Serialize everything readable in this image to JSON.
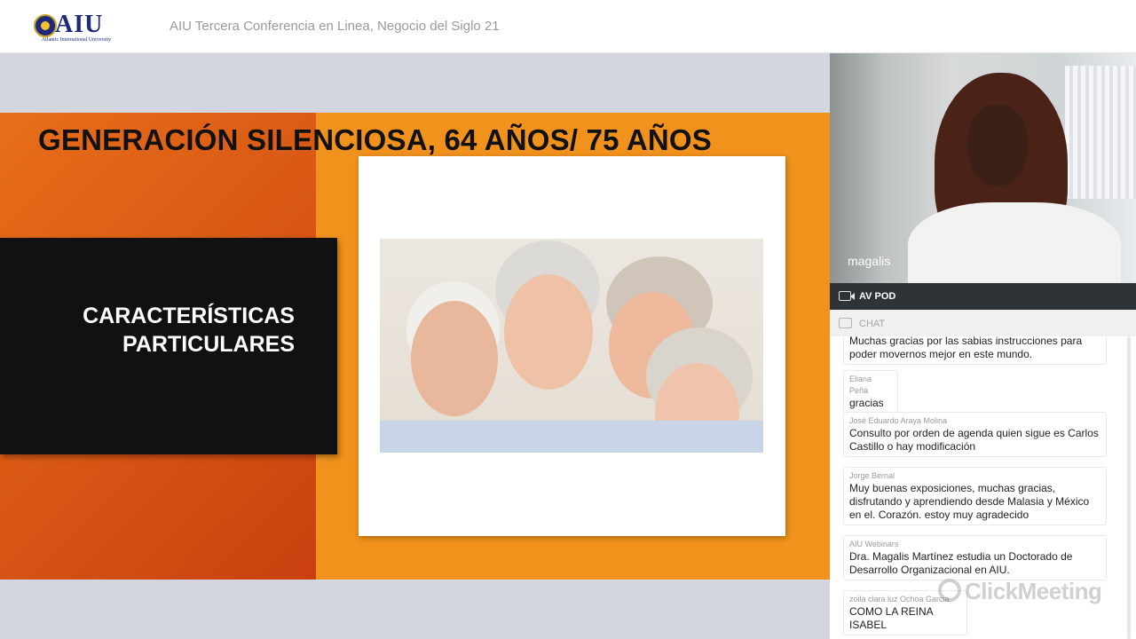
{
  "header": {
    "logo_text": "AIU",
    "logo_subtext": "Atlantic International University",
    "conference_title": "AIU Tercera Conferencia en Linea, Negocio del Siglo 21"
  },
  "slide": {
    "headline": "GENERACIÓN SILENCIOSA, 64 AÑOS/ 75 AÑOS",
    "subtitle_line1": "CARACTERÍSTICAS",
    "subtitle_line2": "PARTICULARES"
  },
  "video": {
    "presenter_name": "magalis",
    "pod_label": "AV POD"
  },
  "chat": {
    "header_label": "CHAT",
    "messages": [
      {
        "author": "",
        "text": "Muchas gracias por las sabias instrucciones para poder movernos mejor en este mundo."
      },
      {
        "author": "Eliana Peña",
        "text": "gracias"
      },
      {
        "author": "José Eduardo Araya Molina",
        "text": "Consulto por orden de agenda quien sigue es Carlos Castillo o hay modificación"
      },
      {
        "author": "Jorge Bernal",
        "text": "Muy buenas exposiciones, muchas gracias, disfrutando y aprendiendo desde Malasia y México en el. Corazón. estoy muy agradecido"
      },
      {
        "author": "AIU Webinars",
        "text": "Dra. Magalis Martínez estudia un Doctorado de Desarrollo Organizacional en AIU."
      },
      {
        "author": "zoila clara luz Ochoa Garcia",
        "text": "COMO LA REINA ISABEL"
      }
    ]
  },
  "watermark": "ClickMeeting",
  "colors": {
    "slide_orange": "#f0921c",
    "slide_dark_orange": "#d2521a",
    "pod_bar": "#2e3338",
    "logo_blue": "#1d2a7a"
  }
}
